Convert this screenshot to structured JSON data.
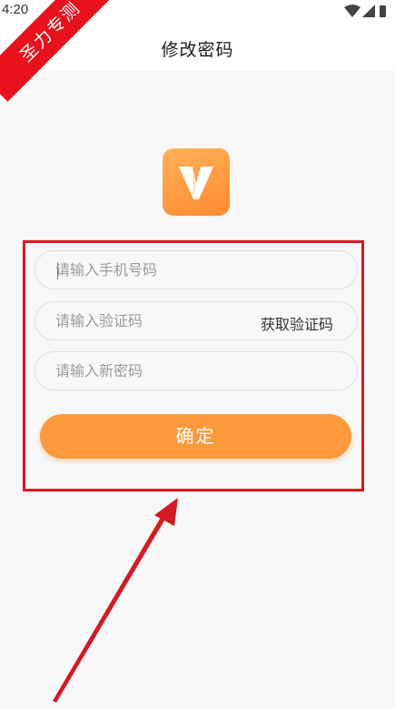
{
  "status_bar": {
    "time": "4:20"
  },
  "header": {
    "title": "修改密码"
  },
  "ribbon": {
    "text": "圣力专测"
  },
  "form": {
    "phone_placeholder": "请输入手机号码",
    "code_placeholder": "请输入验证码",
    "get_code_label": "获取验证码",
    "new_password_placeholder": "请输入新密码",
    "confirm_label": "确定"
  },
  "colors": {
    "accent": "#fd9a3c",
    "ribbon": "#e8111c",
    "annotation": "#e0181f"
  },
  "icons": [
    "wifi-icon",
    "signal-icon",
    "battery-icon",
    "app-logo-icon",
    "annotation-arrow"
  ]
}
